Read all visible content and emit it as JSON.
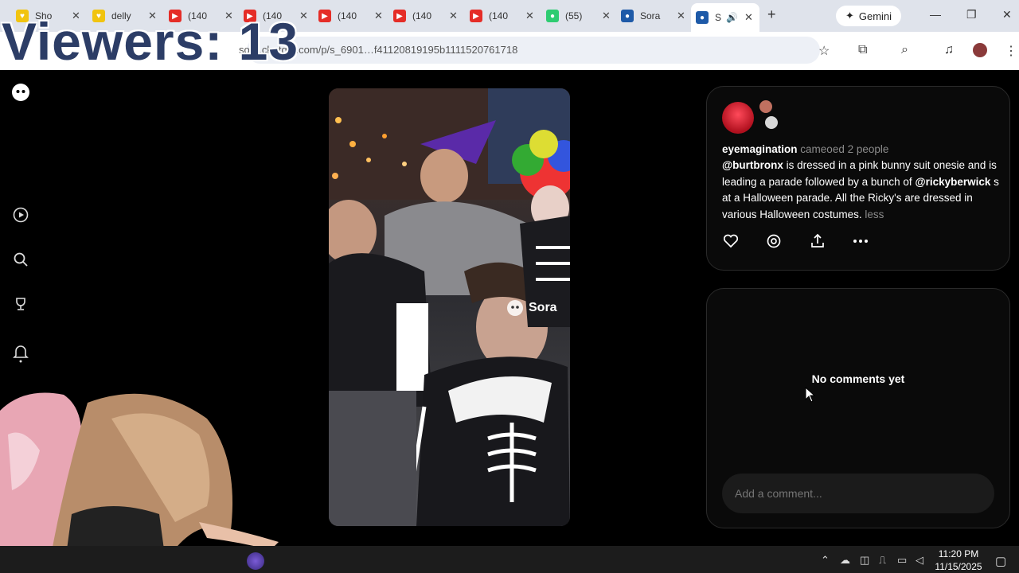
{
  "overlay": {
    "viewers_text": "Viewers: 13"
  },
  "browser": {
    "tabs": [
      {
        "title": "Sho",
        "favicon": "yellow-heart-icon",
        "color": "#f1c40f"
      },
      {
        "title": "delly",
        "favicon": "yellow-heart-icon",
        "color": "#f1c40f"
      },
      {
        "title": "(140",
        "favicon": "youtube-icon",
        "color": "#e52d27"
      },
      {
        "title": "(140",
        "favicon": "youtube-icon",
        "color": "#e52d27"
      },
      {
        "title": "(140",
        "favicon": "youtube-icon",
        "color": "#e52d27"
      },
      {
        "title": "(140",
        "favicon": "youtube-icon",
        "color": "#e52d27"
      },
      {
        "title": "(140",
        "favicon": "youtube-icon",
        "color": "#e52d27"
      },
      {
        "title": "(55)",
        "favicon": "green-app-icon",
        "color": "#2ecc71"
      },
      {
        "title": "Sora",
        "favicon": "sora-icon",
        "color": "#1e5aa8"
      },
      {
        "title": "S",
        "favicon": "sora-icon",
        "color": "#1e5aa8",
        "active": true
      }
    ],
    "new_tab": "+",
    "gemini_label": "Gemini",
    "url": "sora.chatgpt.com/p/s_6901…f41120819195b1111520761718",
    "url_tail": "f41120819195b1111520761718"
  },
  "post": {
    "author": "eyemagination",
    "cameo_text": "cameoed 2 people",
    "mention1": "@burtbronx",
    "text1": " is dressed in a pink bunny suit onesie and is leading a parade followed by a bunch of ",
    "mention2": "@rickyberwick",
    "text2": " s at a Halloween parade. All the Ricky's are dressed in various Halloween costumes. ",
    "less_label": "less"
  },
  "video": {
    "watermark": "Sora"
  },
  "comments": {
    "empty_text": "No comments yet",
    "placeholder": "Add a comment..."
  },
  "taskbar": {
    "time": "11:20 PM",
    "date": "11/15/2025"
  },
  "colors": {
    "accent_red": "#e52d27",
    "panel_border": "#2a2a2a",
    "viewers_text": "#2c3d66"
  }
}
